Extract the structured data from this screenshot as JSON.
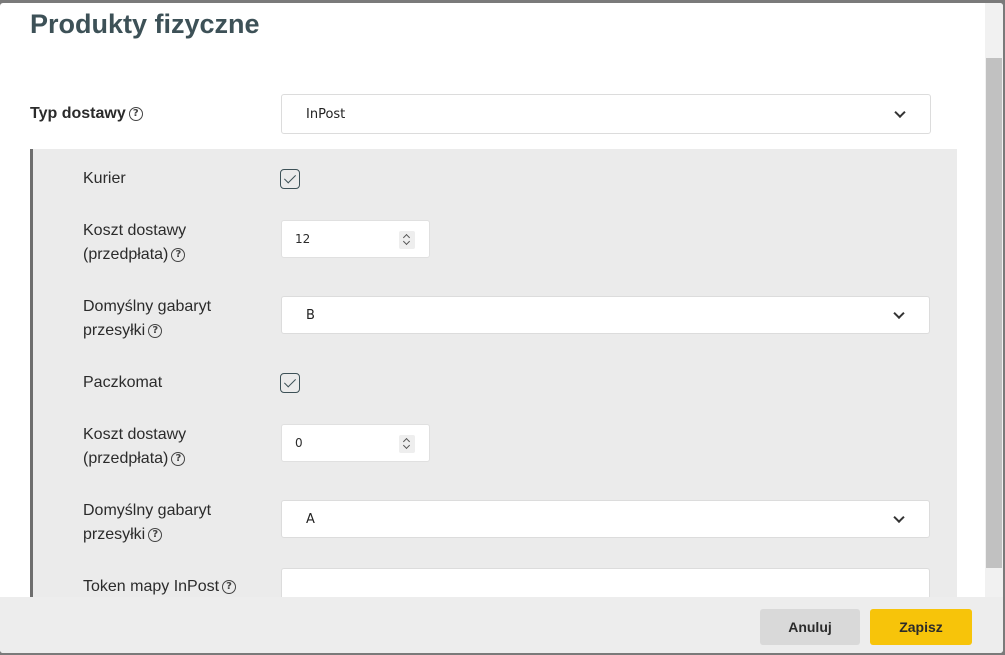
{
  "modal": {
    "title": "Produkty fizyczne",
    "cancel_label": "Anuluj",
    "save_label": "Zapisz"
  },
  "delivery_type": {
    "label": "Typ dostawy",
    "value": "InPost"
  },
  "courier": {
    "label": "Kurier",
    "checked": true,
    "cost_label_line1": "Koszt dostawy",
    "cost_label_line2": "(przedpłata)",
    "cost_value": "12",
    "size_label_line1": "Domyślny gabaryt",
    "size_label_line2": "przesyłki",
    "size_value": "B"
  },
  "locker": {
    "label": "Paczkomat",
    "checked": true,
    "cost_label_line1": "Koszt dostawy",
    "cost_label_line2": "(przedpłata)",
    "cost_value": "0",
    "size_label_line1": "Domyślny gabaryt",
    "size_label_line2": "przesyłki",
    "size_value": "A"
  },
  "map_token": {
    "label": "Token mapy InPost",
    "value": ""
  },
  "icons": {
    "help": "?"
  },
  "colors": {
    "title": "#3d5157",
    "save_button": "#f7c40a",
    "panel_bg": "#ebebeb"
  }
}
